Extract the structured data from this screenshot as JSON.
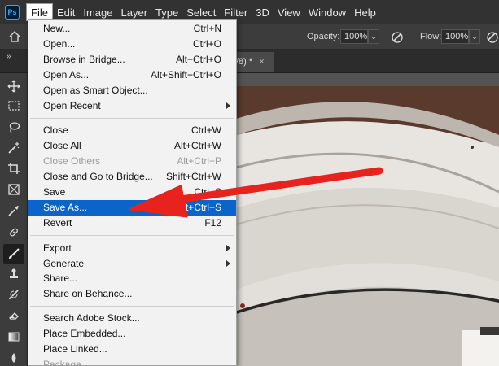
{
  "app": {
    "logo_text": "Ps"
  },
  "menubar": {
    "items": [
      "File",
      "Edit",
      "Image",
      "Layer",
      "Type",
      "Select",
      "Filter",
      "3D",
      "View",
      "Window",
      "Help"
    ]
  },
  "options_bar": {
    "opacity_label": "Opacity:",
    "opacity_value": "100%",
    "flow_label": "Flow:",
    "flow_value": "100%"
  },
  "tab_row": {
    "panel_toggle": "»",
    "document_tab": "/8) *",
    "close_glyph": "×"
  },
  "file_menu": {
    "items": [
      {
        "label": "New...",
        "shortcut": "Ctrl+N",
        "enabled": true
      },
      {
        "label": "Open...",
        "shortcut": "Ctrl+O",
        "enabled": true
      },
      {
        "label": "Browse in Bridge...",
        "shortcut": "Alt+Ctrl+O",
        "enabled": true
      },
      {
        "label": "Open As...",
        "shortcut": "Alt+Shift+Ctrl+O",
        "enabled": true
      },
      {
        "label": "Open as Smart Object...",
        "shortcut": "",
        "enabled": true
      },
      {
        "label": "Open Recent",
        "shortcut": "",
        "enabled": true,
        "submenu": true
      },
      {
        "label": "Close",
        "shortcut": "Ctrl+W",
        "enabled": true
      },
      {
        "label": "Close All",
        "shortcut": "Alt+Ctrl+W",
        "enabled": true
      },
      {
        "label": "Close Others",
        "shortcut": "Alt+Ctrl+P",
        "enabled": false
      },
      {
        "label": "Close and Go to Bridge...",
        "shortcut": "Shift+Ctrl+W",
        "enabled": true
      },
      {
        "label": "Save",
        "shortcut": "Ctrl+S",
        "enabled": true
      },
      {
        "label": "Save As...",
        "shortcut": "Shift+Ctrl+S",
        "enabled": true,
        "highlighted": true
      },
      {
        "label": "Revert",
        "shortcut": "F12",
        "enabled": true
      },
      {
        "label": "Export",
        "shortcut": "",
        "enabled": true,
        "submenu": true
      },
      {
        "label": "Generate",
        "shortcut": "",
        "enabled": true,
        "submenu": true
      },
      {
        "label": "Share...",
        "shortcut": "",
        "enabled": true
      },
      {
        "label": "Share on Behance...",
        "shortcut": "",
        "enabled": true
      },
      {
        "label": "Search Adobe Stock...",
        "shortcut": "",
        "enabled": true
      },
      {
        "label": "Place Embedded...",
        "shortcut": "",
        "enabled": true
      },
      {
        "label": "Place Linked...",
        "shortcut": "",
        "enabled": true
      },
      {
        "label": "Package...",
        "shortcut": "",
        "enabled": false
      }
    ]
  },
  "toolbar": {
    "tools": [
      "move-tool",
      "marquee-tool",
      "lasso-tool",
      "magic-wand-tool",
      "crop-tool",
      "frame-tool",
      "eyedropper-tool",
      "healing-brush-tool",
      "brush-tool",
      "clone-stamp-tool",
      "history-brush-tool",
      "eraser-tool",
      "gradient-tool",
      "blur-tool"
    ],
    "selected": "brush-tool"
  },
  "annotation": {
    "type": "red-arrow",
    "points_to": "Save As...",
    "color": "#e8221c"
  },
  "colors": {
    "menu_highlight": "#0a64c9",
    "menubar_bg": "#323232",
    "panel_bg": "#3c3c3c",
    "menu_bg": "#f2f2f2"
  }
}
